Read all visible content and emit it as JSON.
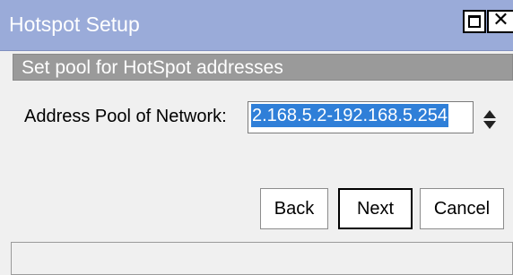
{
  "window": {
    "title": "Hotspot Setup",
    "controls": {
      "maximize_icon": "maximize-icon",
      "close_icon": "close-icon",
      "close_glyph": "✕"
    }
  },
  "step": {
    "header": "Set pool for HotSpot addresses"
  },
  "form": {
    "address_pool_label": "Address Pool of Network:",
    "address_pool_value": "2.168.5.2-192.168.5.254",
    "spinner_icon": "up-down-spinner-icon"
  },
  "buttons": {
    "back": "Back",
    "next": "Next",
    "cancel": "Cancel"
  },
  "status": {
    "text": ""
  },
  "colors": {
    "titlebar": "#9aabd9",
    "step_header": "#9a9a9a",
    "selection": "#2f7fd8"
  }
}
